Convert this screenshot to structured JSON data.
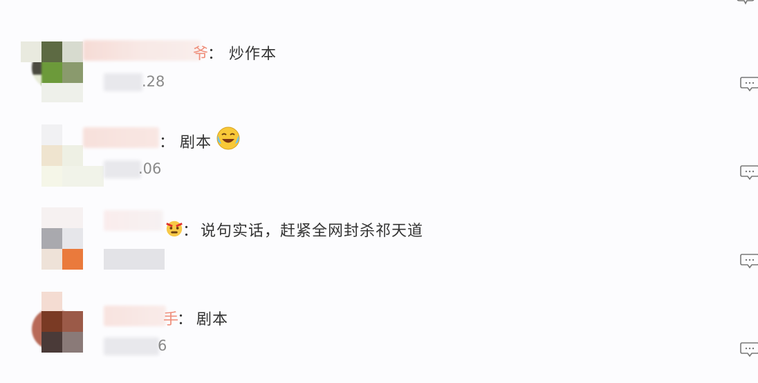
{
  "comments": [
    {
      "name_tail": "爷",
      "separator": "：",
      "content": "炒作本",
      "time_tail": ".28",
      "reply_icon": "comment-bubble-icon"
    },
    {
      "name_tail": "",
      "separator": "：",
      "content": "剧本",
      "emoji": "laughing-crying-emoji",
      "time_tail": ".06",
      "reply_icon": "comment-bubble-icon"
    },
    {
      "name_tail": "",
      "separator": "：",
      "content": "说句实话，赶紧全网封杀祁天道",
      "emoji_before": "angry-emoji",
      "time_tail": "",
      "reply_icon": "comment-bubble-icon"
    },
    {
      "name_tail": "手",
      "separator": "：",
      "content": "剧本",
      "time_tail": "6",
      "reply_icon": "comment-bubble-icon"
    }
  ]
}
